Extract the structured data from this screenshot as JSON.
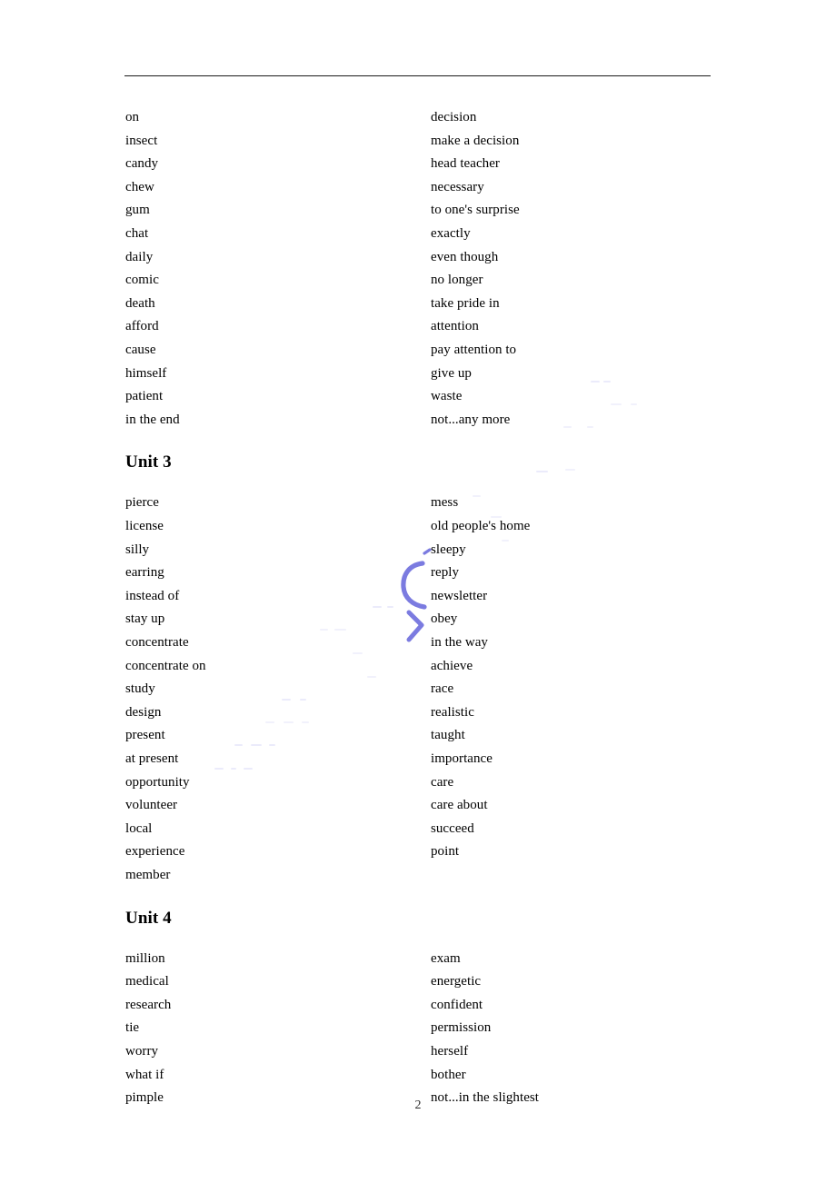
{
  "document": {
    "page_number": "2",
    "ink_color": "#7b7be0",
    "rule_color": "#1a1a1a",
    "text_color": "#000000"
  },
  "blocks": [
    {
      "heading": null,
      "left": [
        "on",
        "insect",
        "candy",
        "chew",
        "gum",
        "chat",
        "daily",
        "comic",
        "death",
        "afford",
        "cause",
        "himself",
        "patient",
        "in the end"
      ],
      "right": [
        "decision",
        "make a decision",
        "head teacher",
        "necessary",
        "to one's surprise",
        "exactly",
        "even though",
        "no longer",
        "take pride in",
        "attention",
        "pay attention to",
        "give up",
        "waste",
        "not...any more"
      ]
    },
    {
      "heading": "Unit 3",
      "left": [
        "pierce",
        "license",
        "silly",
        "earring",
        "instead of",
        "stay up",
        "concentrate",
        "concentrate on",
        "study",
        "design",
        "present",
        "at present",
        "opportunity",
        "volunteer",
        "local",
        "experience",
        "member"
      ],
      "right": [
        "mess",
        "old people's home",
        "sleepy",
        "reply",
        "newsletter",
        "obey",
        "in the way",
        "achieve",
        "race",
        "realistic",
        "taught",
        "importance",
        "care",
        "care about",
        "succeed",
        "point"
      ]
    },
    {
      "heading": "Unit 4",
      "left": [
        "million",
        "medical",
        "research",
        "tie",
        "worry",
        "what if",
        "pimple"
      ],
      "right": [
        "exam",
        "energetic",
        "confident",
        "permission",
        "herself",
        "bother",
        "not...in the slightest"
      ]
    }
  ],
  "annotations": [
    {
      "name": "ink-bracket-mark",
      "kind": "handwritten-ink"
    }
  ]
}
